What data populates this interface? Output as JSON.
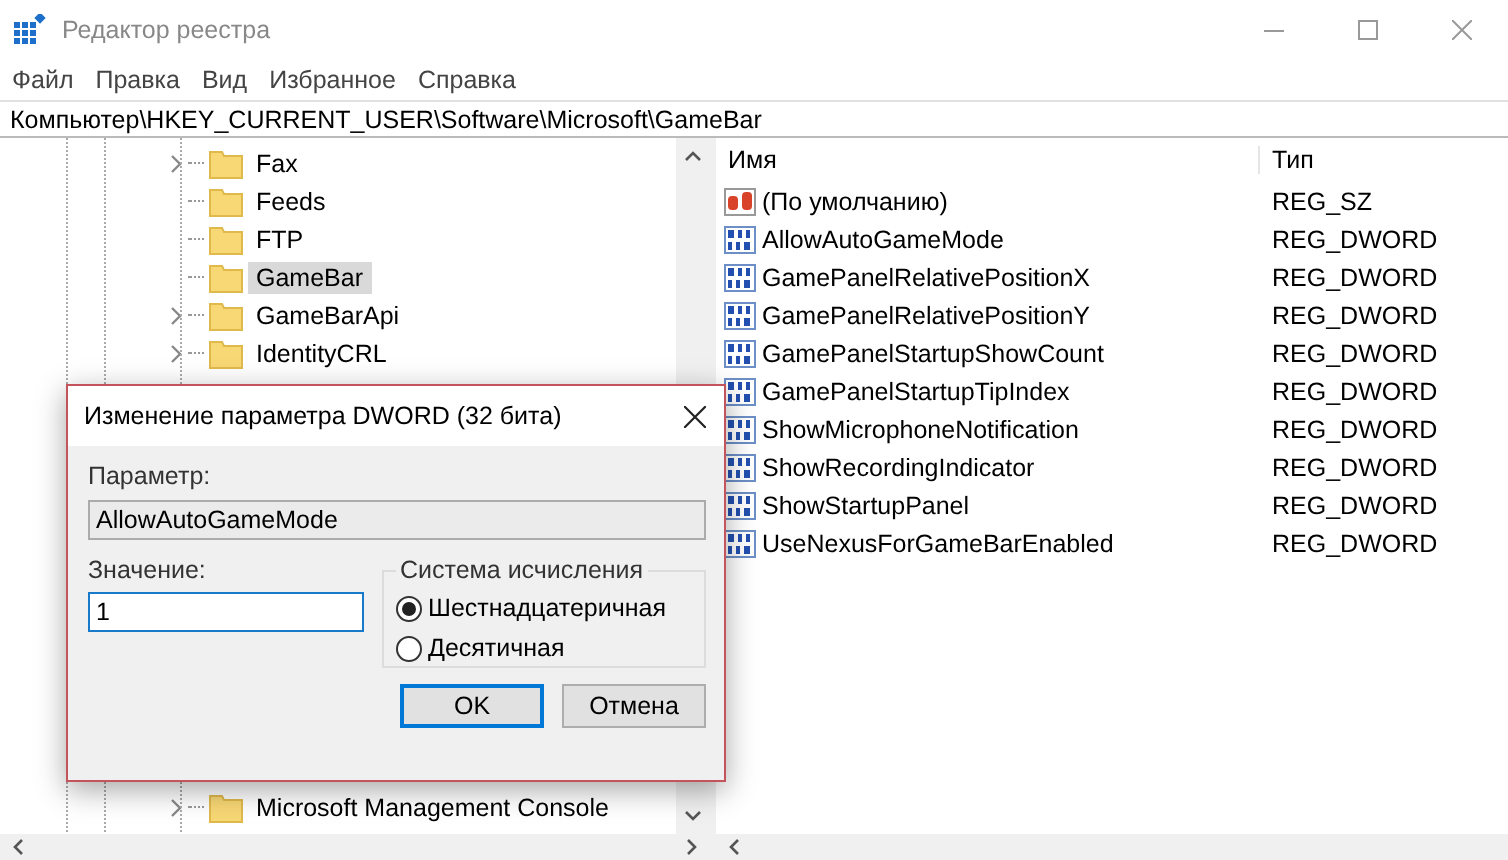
{
  "window": {
    "title": "Редактор реестра"
  },
  "menu": [
    "Файл",
    "Правка",
    "Вид",
    "Избранное",
    "Справка"
  ],
  "address": "Компьютер\\HKEY_CURRENT_USER\\Software\\Microsoft\\GameBar",
  "tree": {
    "items": [
      {
        "label": "Fax",
        "expandable": true,
        "selected": false
      },
      {
        "label": "Feeds",
        "expandable": false,
        "selected": false
      },
      {
        "label": "FTP",
        "expandable": false,
        "selected": false
      },
      {
        "label": "GameBar",
        "expandable": false,
        "selected": true
      },
      {
        "label": "GameBarApi",
        "expandable": true,
        "selected": false
      },
      {
        "label": "IdentityCRL",
        "expandable": true,
        "selected": false
      }
    ],
    "bottom_items": [
      {
        "label": "Microsoft Management Console",
        "expandable": true,
        "selected": false
      }
    ]
  },
  "values": {
    "columns": [
      "Имя",
      "Тип"
    ],
    "rows": [
      {
        "kind": "string",
        "name": "(По умолчанию)",
        "type": "REG_SZ"
      },
      {
        "kind": "dword",
        "name": "AllowAutoGameMode",
        "type": "REG_DWORD"
      },
      {
        "kind": "dword",
        "name": "GamePanelRelativePositionX",
        "type": "REG_DWORD"
      },
      {
        "kind": "dword",
        "name": "GamePanelRelativePositionY",
        "type": "REG_DWORD"
      },
      {
        "kind": "dword",
        "name": "GamePanelStartupShowCount",
        "type": "REG_DWORD"
      },
      {
        "kind": "dword",
        "name": "GamePanelStartupTipIndex",
        "type": "REG_DWORD"
      },
      {
        "kind": "dword",
        "name": "ShowMicrophoneNotification",
        "type": "REG_DWORD"
      },
      {
        "kind": "dword",
        "name": "ShowRecordingIndicator",
        "type": "REG_DWORD"
      },
      {
        "kind": "dword",
        "name": "ShowStartupPanel",
        "type": "REG_DWORD"
      },
      {
        "kind": "dword",
        "name": "UseNexusForGameBarEnabled",
        "type": "REG_DWORD"
      }
    ]
  },
  "dialog": {
    "title": "Изменение параметра DWORD (32 бита)",
    "param_label": "Параметр:",
    "param_value": "AllowAutoGameMode",
    "value_label": "Значение:",
    "value": "1",
    "base_group": "Система исчисления",
    "bases": [
      {
        "label": "Шестнадцатеричная",
        "selected": true
      },
      {
        "label": "Десятичная",
        "selected": false
      }
    ],
    "buttons": [
      {
        "label": "OK",
        "default": true
      },
      {
        "label": "Отмена",
        "default": false
      }
    ]
  }
}
